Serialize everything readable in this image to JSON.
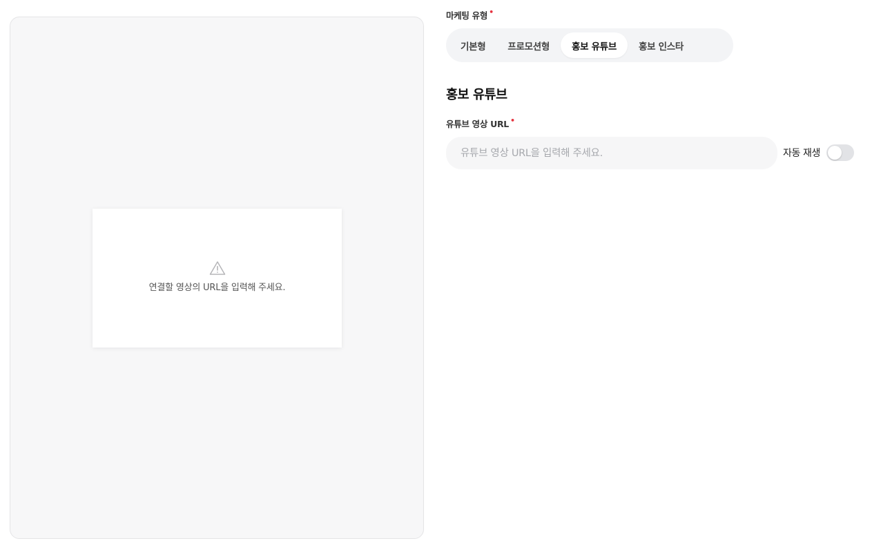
{
  "preview": {
    "message": "연결할 영상의 URL을 입력해 주세요.",
    "icon": "warning-icon"
  },
  "form": {
    "marketing_type": {
      "label": "마케팅 유형",
      "required_mark": "•",
      "options": [
        "기본형",
        "프로모션형",
        "홍보 유튜브",
        "홍보 인스타"
      ],
      "selected": "홍보 유튜브"
    },
    "section_title": "홍보 유튜브",
    "youtube_url": {
      "label": "유튜브 영상 URL",
      "required_mark": "•",
      "value": "",
      "placeholder": "유튜브 영상 URL을 입력해 주세요."
    },
    "autoplay": {
      "label": "자동 재생",
      "enabled": false
    }
  },
  "colors": {
    "required": "#e5323e",
    "segment_bg": "#f3f4f6",
    "preview_bg": "#f7f7f8"
  }
}
